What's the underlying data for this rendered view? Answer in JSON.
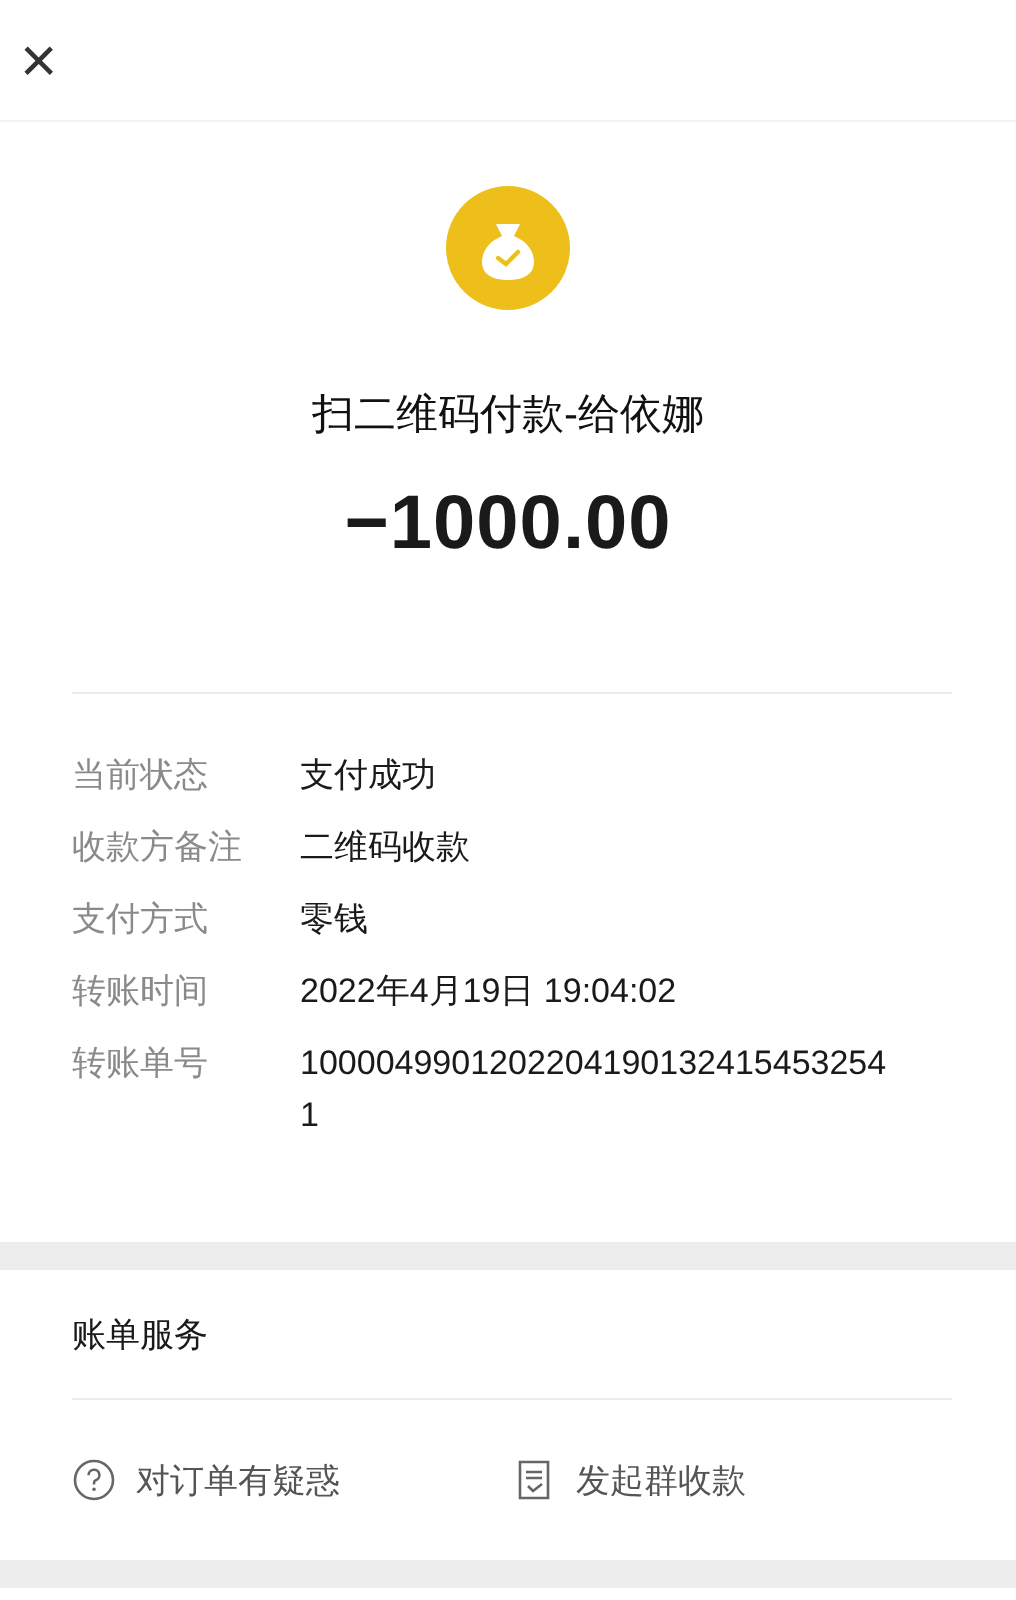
{
  "header": {
    "close": "×"
  },
  "payment": {
    "title": "扫二维码付款-给依娜",
    "amount": "−1000.00"
  },
  "details": [
    {
      "label": "当前状态",
      "value": "支付成功"
    },
    {
      "label": "收款方备注",
      "value": "二维码收款"
    },
    {
      "label": "支付方式",
      "value": "零钱"
    },
    {
      "label": "转账时间",
      "value": "2022年4月19日 19:04:02"
    },
    {
      "label": "转账单号",
      "value": "10000499012022041901324154532541"
    }
  ],
  "services": {
    "title": "账单服务",
    "actions": [
      {
        "kind": "question",
        "label": "对订单有疑惑"
      },
      {
        "kind": "split",
        "label": "发起群收款"
      }
    ]
  }
}
